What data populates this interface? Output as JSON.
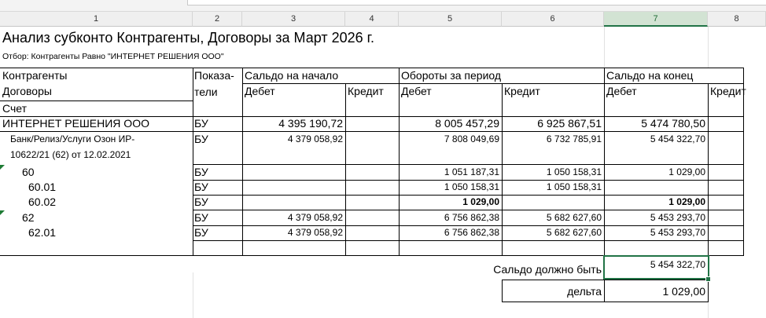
{
  "columns": [
    "1",
    "2",
    "3",
    "4",
    "5",
    "6",
    "7",
    "8"
  ],
  "title": "Анализ субконто Контрагенты, Договоры за Март 2026 г.",
  "filter": "Отбор: Контрагенты Равно \"ИНТЕРНЕТ РЕШЕНИЯ ООО\"",
  "headers": {
    "kontragenty": "Контрагенты",
    "dogovory": "Договоры",
    "schet": "Счет",
    "pokaza": "Показа-",
    "teli": "тели",
    "saldo_nach": "Сальдо на начало",
    "oboroty": "Обороты за период",
    "saldo_kon": "Сальдо на конец",
    "debet": "Дебет",
    "kredit": "Кредит"
  },
  "rows": [
    {
      "name": "ИНТЕРНЕТ РЕШЕНИЯ ООО",
      "ind": "БУ",
      "sn_d": "4 395 190,72",
      "sn_k": "",
      "ob_d": "8 005 457,29",
      "ob_k": "6 925 867,51",
      "sk_d": "5 474 780,50",
      "sk_k": ""
    },
    {
      "name": "Банк/Релиз/Услуги Озон ИР-",
      "name2": "10622/21 (62) от 12.02.2021",
      "ind": "БУ",
      "sn_d": "4 379 058,92",
      "sn_k": "",
      "ob_d": "7 808 049,69",
      "ob_k": "6 732 785,91",
      "sk_d": "5 454 322,70",
      "sk_k": ""
    },
    {
      "name": "60",
      "ind": "БУ",
      "sn_d": "",
      "sn_k": "",
      "ob_d": "1 051 187,31",
      "ob_k": "1 050 158,31",
      "sk_d": "1 029,00",
      "sk_k": ""
    },
    {
      "name": "60.01",
      "ind": "БУ",
      "sn_d": "",
      "sn_k": "",
      "ob_d": "1 050 158,31",
      "ob_k": "1 050 158,31",
      "sk_d": "",
      "sk_k": ""
    },
    {
      "name": "60.02",
      "ind": "БУ",
      "sn_d": "",
      "sn_k": "",
      "ob_d": "1 029,00",
      "ob_k": "",
      "sk_d": "1 029,00",
      "sk_k": ""
    },
    {
      "name": "62",
      "ind": "БУ",
      "sn_d": "4 379 058,92",
      "sn_k": "",
      "ob_d": "6 756 862,38",
      "ob_k": "5 682 627,60",
      "sk_d": "5 453 293,70",
      "sk_k": ""
    },
    {
      "name": "62.01",
      "ind": "БУ",
      "sn_d": "4 379 058,92",
      "sn_k": "",
      "ob_d": "6 756 862,38",
      "ob_k": "5 682 627,60",
      "sk_d": "5 453 293,70",
      "sk_k": ""
    }
  ],
  "footer": {
    "saldo_label": "Сальдо должно быть",
    "saldo_value": "5 454 322,70",
    "delta_label": "дельта",
    "delta_value": "1 029,00"
  },
  "colors": {
    "selection": "#217346",
    "note_marker": "#1e7b34"
  }
}
